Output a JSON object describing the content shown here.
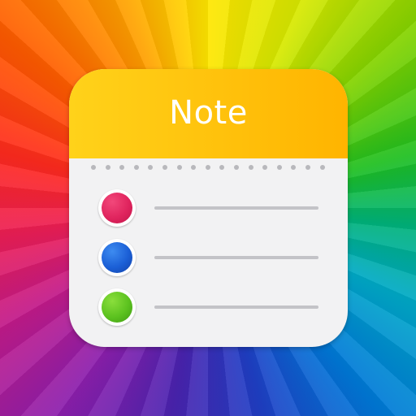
{
  "app": {
    "title": "Note"
  },
  "list": {
    "items": [
      {
        "icon": "red-bullet-icon",
        "color": "#e0245e"
      },
      {
        "icon": "blue-bullet-icon",
        "color": "#1b5fd6"
      },
      {
        "icon": "green-bullet-icon",
        "color": "#5cc21f"
      }
    ]
  },
  "colors": {
    "header_start": "#ffd21a",
    "header_end": "#ffb400",
    "card_background": "#f2f2f3",
    "line": "#c3c3c7"
  }
}
